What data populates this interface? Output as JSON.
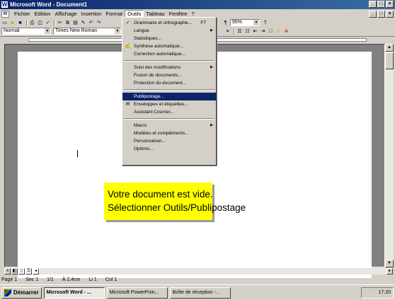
{
  "window": {
    "title": "Microsoft Word - Document1",
    "app_icon": "W",
    "buttons": [
      "_",
      "□",
      "×"
    ]
  },
  "menubar": {
    "items": [
      "Fichier",
      "Edition",
      "Affichage",
      "Insertion",
      "Format",
      "Outils",
      "Tableau",
      "Fenêtre",
      "?"
    ],
    "active": "Outils"
  },
  "toolbar": {
    "style": "Normal",
    "font": "Times New Roman",
    "zoom": "95%"
  },
  "tools_menu": {
    "items": [
      {
        "label": "Grammaire et orthographe...",
        "shortcut": "F7",
        "icon": "spellcheck-icon"
      },
      {
        "label": "Langue",
        "submenu": true
      },
      {
        "label": "Statistiques..."
      },
      {
        "label": "Synthèse automatique...",
        "icon": "summary-icon"
      },
      {
        "label": "Correction automatique..."
      },
      {
        "separator": true
      },
      {
        "label": "Suivi des modifications",
        "submenu": true
      },
      {
        "label": "Fusion de documents..."
      },
      {
        "label": "Protection du document..."
      },
      {
        "separator": true
      },
      {
        "label": "Publipostage...",
        "highlighted": true
      },
      {
        "label": "Enveloppes et étiquettes...",
        "icon": "envelope-icon"
      },
      {
        "label": "Assistant Courrier..."
      },
      {
        "separator": true
      },
      {
        "label": "Macro",
        "submenu": true
      },
      {
        "label": "Modèles et compléments..."
      },
      {
        "label": "Personnaliser..."
      },
      {
        "label": "Options..."
      }
    ]
  },
  "callout": {
    "line1": "Votre document est vide.",
    "line2": "Sélectionner Outils/Publipostage"
  },
  "statusbar": {
    "page": "Page 1",
    "section": "Sec 1",
    "pages": "1/1",
    "position": "À 2,4cm",
    "line": "Li 1",
    "column": "Col 1"
  },
  "taskbar": {
    "start": "Démarrer",
    "tasks": [
      {
        "label": "Microsoft Word - ...",
        "active": true
      },
      {
        "label": "Microsoft PowerPoin...",
        "active": false
      },
      {
        "label": "Boîte de réception -...",
        "active": false
      }
    ],
    "clock": "17:20"
  }
}
